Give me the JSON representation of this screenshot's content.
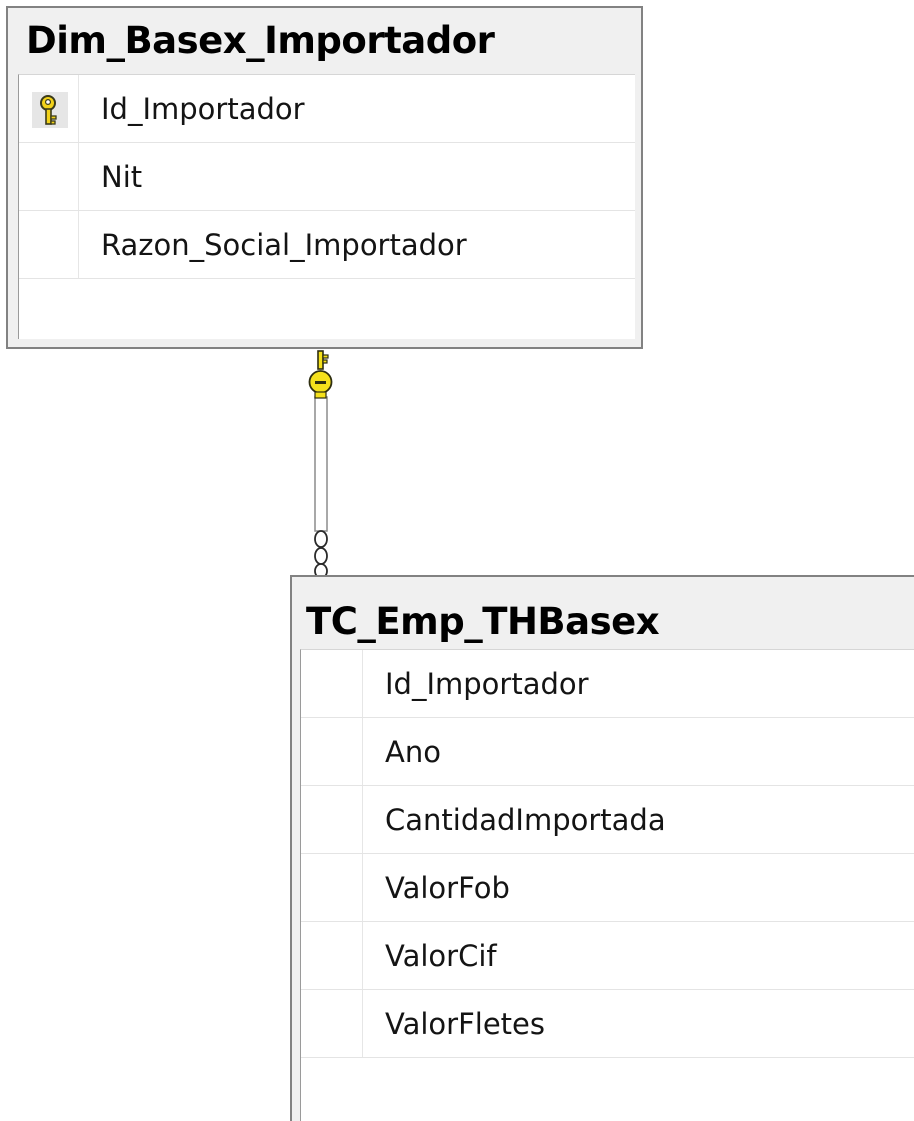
{
  "tables": [
    {
      "title": "Dim_Basex_Importador",
      "columns": [
        {
          "name": "Id_Importador",
          "primary_key": true,
          "icon": "primary-key-icon"
        },
        {
          "name": "Nit",
          "primary_key": false
        },
        {
          "name": "Razon_Social_Importador",
          "primary_key": false
        }
      ]
    },
    {
      "title": "TC_Emp_THBasex",
      "columns": [
        {
          "name": "Id_Importador",
          "primary_key": false
        },
        {
          "name": "Ano",
          "primary_key": false
        },
        {
          "name": "CantidadImportada",
          "primary_key": false
        },
        {
          "name": "ValorFob",
          "primary_key": false
        },
        {
          "name": "ValorCif",
          "primary_key": false
        },
        {
          "name": "ValorFletes",
          "primary_key": false
        }
      ]
    }
  ],
  "relationship": {
    "from": "Dim_Basex_Importador",
    "to": "TC_Emp_THBasex",
    "one_end_icon": "key-icon",
    "many_end_icon": "infinity-icon"
  },
  "colors": {
    "key_yellow": "#f5e11c",
    "line_gray": "#8c8c8c",
    "border_gray": "#828282"
  }
}
